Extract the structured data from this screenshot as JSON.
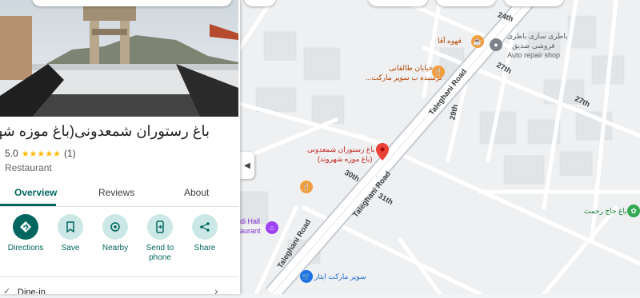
{
  "panel": {
    "title": "باغ رستوران شمعدونی(باغ موزه شهروند)",
    "rating": "5.0",
    "stars": "★★★★★",
    "review_count": "(1)",
    "category": "Restaurant",
    "tabs": [
      {
        "label": "Overview"
      },
      {
        "label": "Reviews"
      },
      {
        "label": "About"
      }
    ],
    "actions": [
      {
        "label": "Directions",
        "icon": "directions-icon"
      },
      {
        "label": "Save",
        "icon": "bookmark-icon"
      },
      {
        "label": "Nearby",
        "icon": "nearby-icon"
      },
      {
        "label": "Send to phone",
        "icon": "phone-icon"
      },
      {
        "label": "Share",
        "icon": "share-icon"
      }
    ],
    "dine_in": "Dine-in"
  },
  "map": {
    "roads": {
      "taleghani_upper": "Taleghani Road",
      "taleghani_middle": "Taleghani Road",
      "taleghani_lower": "Taleghani Road",
      "r24": "24th",
      "r27a": "27th",
      "r27b": "27th",
      "r29": "29th",
      "r30": "30th",
      "r31": "31th"
    },
    "places": {
      "cafe": "قهوه آقا",
      "auto_fa1": "باطری سازی باطری",
      "auto_fa2": "فروشی صدیق",
      "auto_en": "Auto repair shop",
      "tailor1": "خیابان طالقانی",
      "tailor2": "...نرسیده ب سوپر مارکت",
      "selected1": "باغ رستوران شمعدونی",
      "selected2": "(باغ موزه شهروند)",
      "hall1": "di Hall",
      "hall2": "aurant",
      "market": "سوپر مارکت ایثار",
      "garden": "باغ حاج رحمت"
    }
  }
}
